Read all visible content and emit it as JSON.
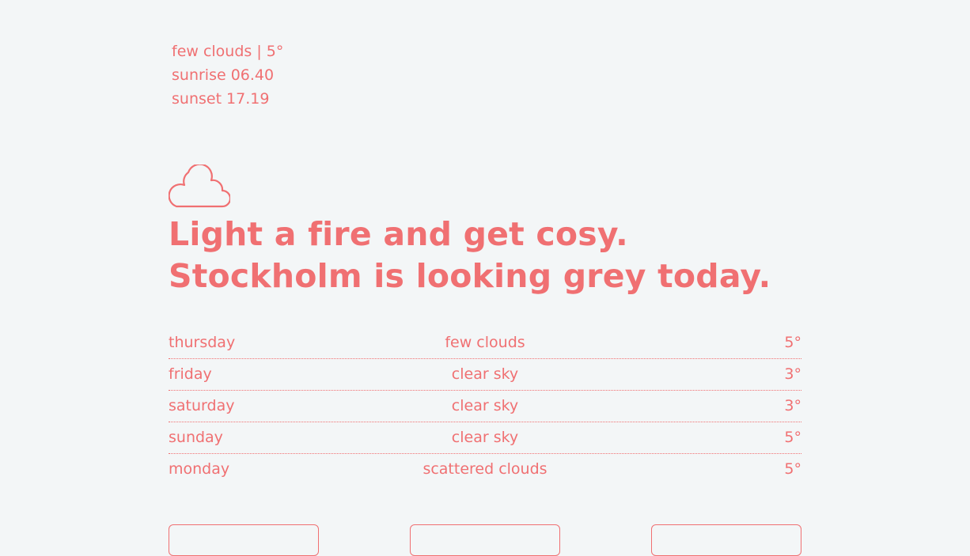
{
  "current": {
    "conditions": "few clouds | 5°",
    "sunrise": "sunrise 06.40",
    "sunset": "sunset 17.19"
  },
  "icon": "cloud-icon",
  "headline": "Light a fire and get cosy. Stockholm is looking grey today.",
  "forecast": [
    {
      "day": "thursday",
      "description": "few clouds",
      "temp": "5°"
    },
    {
      "day": "friday",
      "description": "clear sky",
      "temp": "3°"
    },
    {
      "day": "saturday",
      "description": "clear sky",
      "temp": "3°"
    },
    {
      "day": "sunday",
      "description": "clear sky",
      "temp": "5°"
    },
    {
      "day": "monday",
      "description": "scattered clouds",
      "temp": "5°"
    }
  ],
  "colors": {
    "accent": "#f07072",
    "background": "#f3f6f7"
  }
}
